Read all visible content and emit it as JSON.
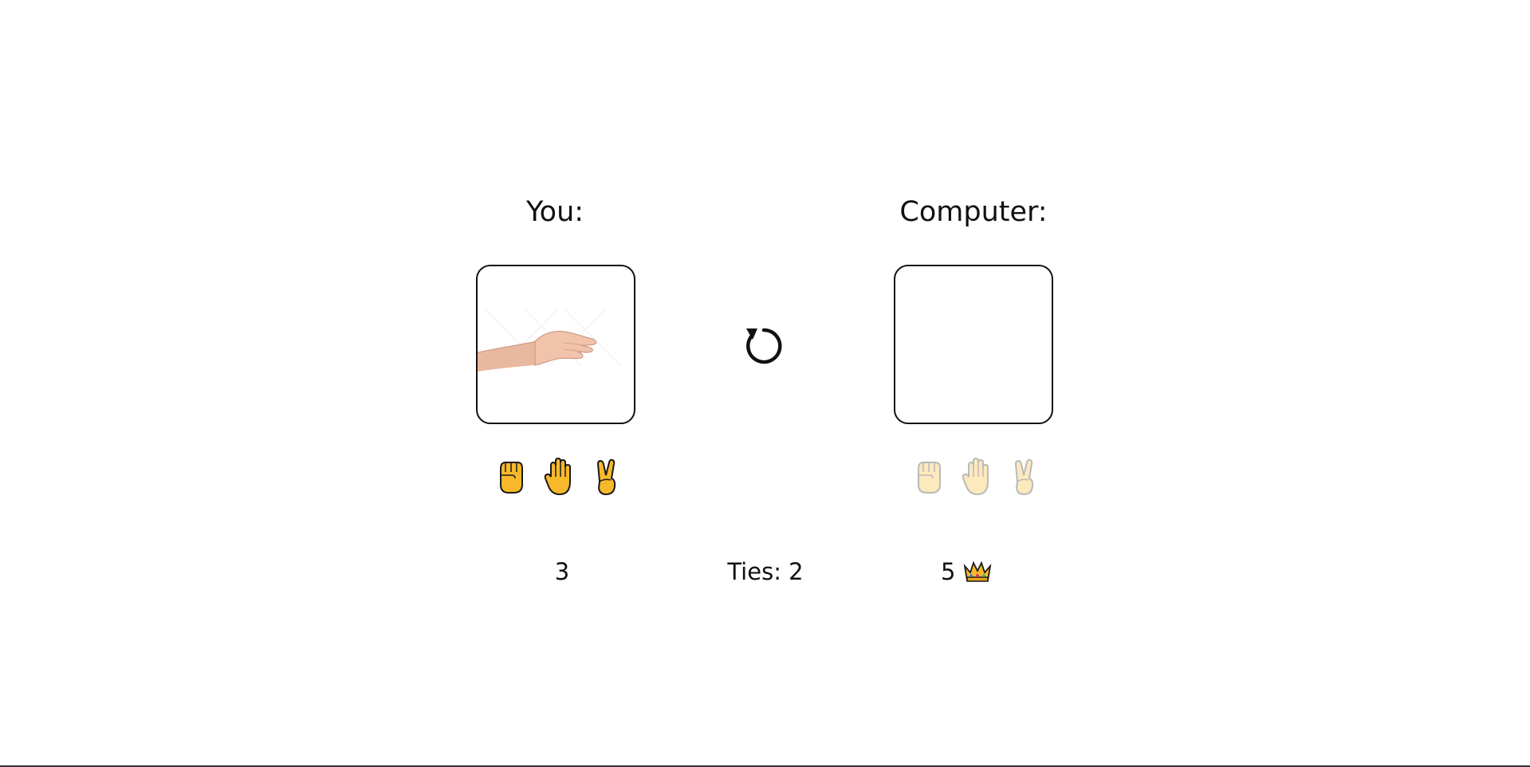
{
  "player": {
    "label": "You:",
    "score": "3",
    "current_choice": "paper",
    "choice_image": "hand-flat-paper-photo",
    "moves": [
      {
        "name": "rock",
        "icon": "raised-fist-icon"
      },
      {
        "name": "paper",
        "icon": "raised-hand-icon"
      },
      {
        "name": "scissors",
        "icon": "victory-hand-icon"
      }
    ]
  },
  "computer": {
    "label": "Computer:",
    "score": "5",
    "leader_icon": "crown-icon",
    "current_choice": "",
    "moves": [
      {
        "name": "rock",
        "icon": "raised-fist-icon"
      },
      {
        "name": "paper",
        "icon": "raised-hand-icon"
      },
      {
        "name": "scissors",
        "icon": "victory-hand-icon"
      }
    ]
  },
  "ties": {
    "text": "Ties: 2"
  },
  "controls": {
    "reset_icon": "refresh-icon"
  },
  "colors": {
    "emoji_yellow": "#F7B92A",
    "emoji_outline": "#1a1a1a",
    "faded_fill": "#FBE9C7"
  }
}
